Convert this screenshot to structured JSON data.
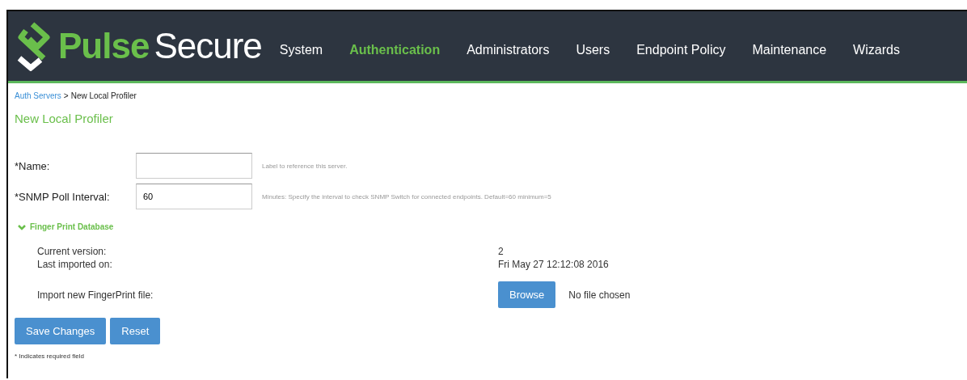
{
  "header": {
    "logo": [
      "Pulse",
      "Secure"
    ],
    "nav": [
      {
        "label": "System",
        "selected": false
      },
      {
        "label": "Authentication",
        "selected": true
      },
      {
        "label": "Administrators",
        "selected": false
      },
      {
        "label": "Users",
        "selected": false
      },
      {
        "label": "Endpoint Policy",
        "selected": false
      },
      {
        "label": "Maintenance",
        "selected": false
      },
      {
        "label": "Wizards",
        "selected": false
      }
    ]
  },
  "breadcrumb": {
    "link": "Auth Servers",
    "separator": ">",
    "current": "New Local Profiler"
  },
  "title": "New Local Profiler",
  "fields": [
    {
      "label": "*Name:",
      "hint": "Label to reference this server."
    },
    {
      "label": "*SNMP Poll Interval:",
      "value": "60",
      "hint": "Minutes: Specify the interval to check SNMP Switch for connected endpoints. Default=60 minimum=5"
    }
  ],
  "section": {
    "label": "Finger Print Database",
    "expanded": true,
    "rows": [
      {
        "label": "Current version:",
        "value": "2"
      },
      {
        "label": "Last imported on:",
        "value": "Fri May 27 12:12:08 2016"
      }
    ],
    "import": {
      "label": "Import new FingerPrint file:",
      "button": "Browse",
      "status": "No file chosen"
    }
  },
  "buttons": [
    "Save Changes",
    "Reset"
  ],
  "footnote": "* Indicates required field"
}
